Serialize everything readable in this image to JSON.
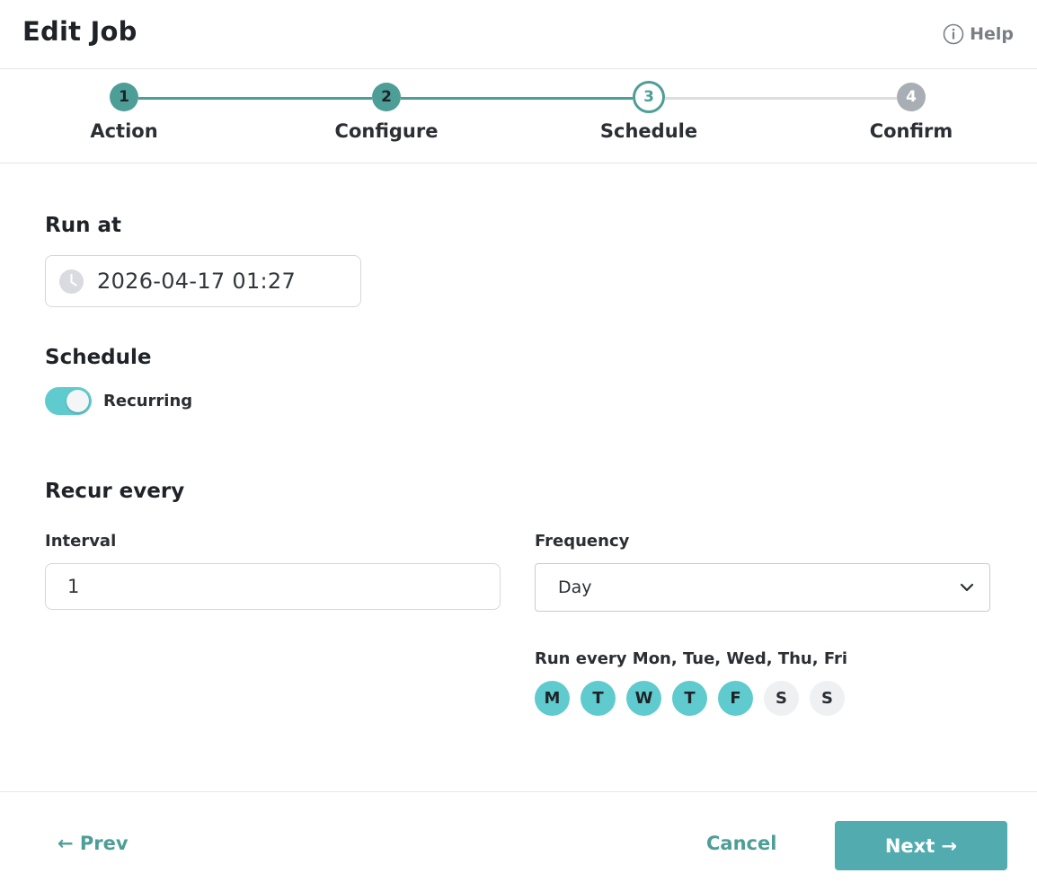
{
  "header": {
    "title": "Edit Job",
    "help_label": "Help"
  },
  "stepper": {
    "steps": [
      {
        "number": "1",
        "label": "Action",
        "state": "done"
      },
      {
        "number": "2",
        "label": "Configure",
        "state": "done"
      },
      {
        "number": "3",
        "label": "Schedule",
        "state": "current"
      },
      {
        "number": "4",
        "label": "Confirm",
        "state": "todo"
      }
    ]
  },
  "run_at": {
    "title": "Run at",
    "value": "2026-04-17 01:27"
  },
  "schedule": {
    "title": "Schedule",
    "recurring_label": "Recurring",
    "recurring_on": true
  },
  "recur": {
    "title": "Recur every",
    "interval_label": "Interval",
    "interval_value": "1",
    "frequency_label": "Frequency",
    "frequency_value": "Day",
    "run_every_text": "Run every Mon, Tue, Wed, Thu, Fri",
    "days": [
      {
        "letter": "M",
        "selected": true
      },
      {
        "letter": "T",
        "selected": true
      },
      {
        "letter": "W",
        "selected": true
      },
      {
        "letter": "T",
        "selected": true
      },
      {
        "letter": "F",
        "selected": true
      },
      {
        "letter": "S",
        "selected": false
      },
      {
        "letter": "S",
        "selected": false
      }
    ]
  },
  "footer": {
    "prev_label": "← Prev",
    "cancel_label": "Cancel",
    "next_label": "Next →"
  },
  "colors": {
    "primary": "#4d9e97",
    "accent": "#5fcbce",
    "button": "#52abaf",
    "inactive": "#a9adb4"
  }
}
